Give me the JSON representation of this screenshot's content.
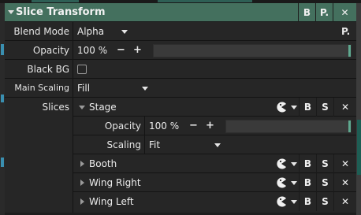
{
  "header": {
    "title": "Slice Transform",
    "btn_b": "B",
    "btn_p": "P.",
    "btn_close": "✕"
  },
  "blend_mode": {
    "label": "Blend Mode",
    "value": "Alpha",
    "pin": "P."
  },
  "opacity": {
    "label": "Opacity",
    "value": "100 %",
    "minus": "−",
    "plus": "+",
    "level": 1.0
  },
  "black_bg": {
    "label": "Black BG",
    "checked": false
  },
  "main_scaling": {
    "label": "Main Scaling",
    "value": "Fill"
  },
  "slices": {
    "label": "Slices",
    "items": [
      {
        "name": "Stage",
        "expanded": true,
        "btn_b": "B",
        "btn_s": "S",
        "btn_close": "✕",
        "opacity": {
          "label": "Opacity",
          "value": "100 %",
          "minus": "−",
          "plus": "+",
          "level": 1.0
        },
        "scaling": {
          "label": "Scaling",
          "value": "Fit"
        }
      },
      {
        "name": "Booth",
        "expanded": false,
        "btn_b": "B",
        "btn_s": "S",
        "btn_close": "✕"
      },
      {
        "name": "Wing Right",
        "expanded": false,
        "btn_b": "B",
        "btn_s": "S",
        "btn_close": "✕"
      },
      {
        "name": "Wing Left",
        "expanded": false,
        "btn_b": "B",
        "btn_s": "S",
        "btn_close": "✕"
      }
    ]
  },
  "colors": {
    "header_bg": "#44705e",
    "panel_bg": "#262626",
    "accent": "#5fa98f"
  },
  "icons": [
    "chevron-down-icon",
    "dropdown-caret-icon",
    "pacman-icon",
    "close-icon",
    "expand-triangle-icon",
    "checkbox-icon"
  ]
}
